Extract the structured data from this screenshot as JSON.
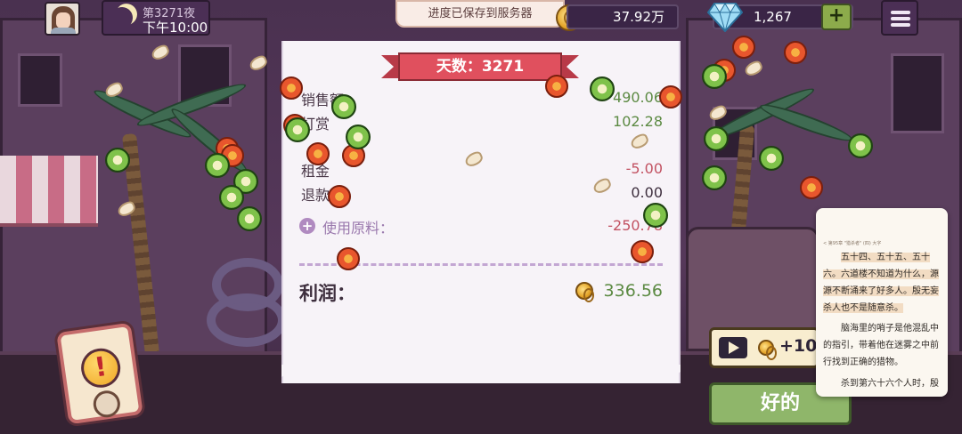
{
  "hud": {
    "night_label": "第3271夜",
    "time_label": "下午10:00",
    "save_toast": "进度已保存到服务器",
    "coins": "37.92万",
    "gems": "1,267",
    "plus_label": "+"
  },
  "receipt": {
    "title": "天数：3271",
    "rows": [
      {
        "label": "销售额",
        "value": "490.06"
      },
      {
        "label": "打赏",
        "value": "102.28"
      },
      {
        "label": "租金",
        "value": "-5.00"
      },
      {
        "label": "退款",
        "value": "0.00"
      },
      {
        "label": "使用原料：",
        "value": "-250.78"
      }
    ],
    "profit_label": "利润：",
    "profit_value": "336.56"
  },
  "ad_reward": {
    "label": "+10"
  },
  "ok_button": "好的",
  "novel": {
    "header": "< 第95章 \"猎杀者\" (四)          大字",
    "paragraphs": [
      "五十四、五十五、五十六。六道楼不知道为什么，源源不断涌来了好多人。殷无妄杀人也不是随意杀。",
      "脑海里的哨子是他混乱中的指引，带着他在迷雾之中前行找到正确的猎物。",
      "杀到第六十六个人时，殷"
    ]
  },
  "colors": {
    "profit_green": "#5c8a43",
    "negative_red": "#c25262",
    "banner_red": "#e0505e",
    "ok_green": "#8fb66a"
  },
  "icons": [
    "moon-icon",
    "coin-icon",
    "diamond-icon",
    "plus-icon",
    "menu-icon",
    "play-icon",
    "exclamation-icon"
  ]
}
